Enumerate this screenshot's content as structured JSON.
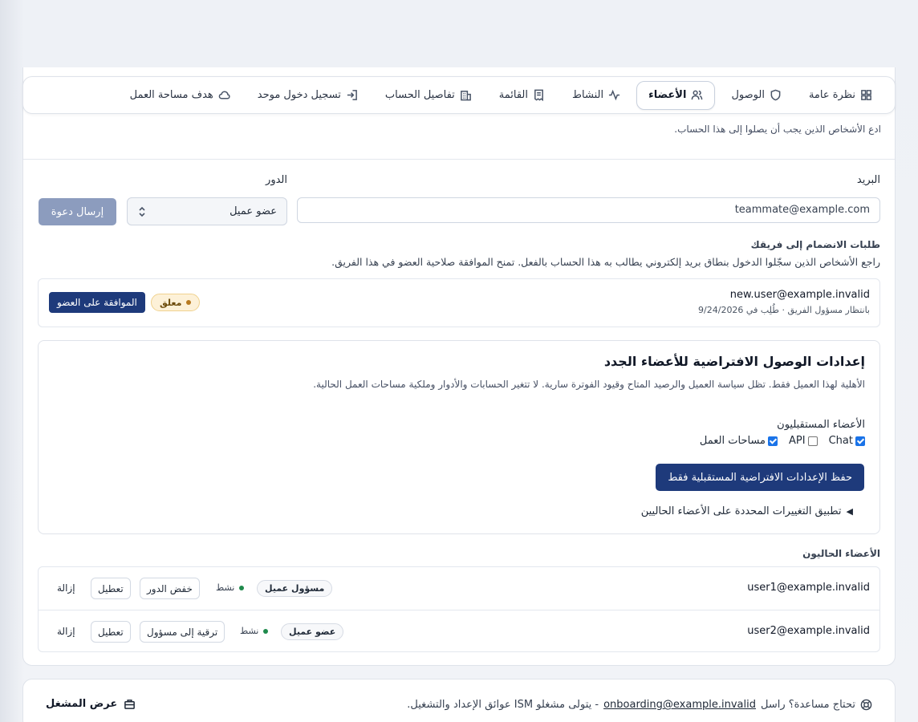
{
  "tabs": [
    {
      "label": "نظرة عامة",
      "icon": "grid-icon"
    },
    {
      "label": "الوصول",
      "icon": "shield-icon"
    },
    {
      "label": "الأعضاء",
      "icon": "users-icon",
      "active": true
    },
    {
      "label": "النشاط",
      "icon": "activity-icon"
    },
    {
      "label": "القائمة",
      "icon": "receipt-icon"
    },
    {
      "label": "تفاصيل الحساب",
      "icon": "building-icon"
    },
    {
      "label": "تسجيل دخول موحد",
      "icon": "sign-in-icon"
    },
    {
      "label": "هدف مساحة العمل",
      "icon": "cloud-icon"
    }
  ],
  "invite": {
    "description": "ادع الأشخاص الذين يجب أن يصلوا إلى هذا الحساب.",
    "email_label": "البريد",
    "email_value": "teammate@example.com",
    "role_label": "الدور",
    "role_value": "عضو عميل",
    "send_button": "إرسال دعوة"
  },
  "join_requests": {
    "title": "طلبات الانضمام إلى فريقك",
    "description": "راجع الأشخاص الذين سجّلوا الدخول بنطاق بريد إلكتروني يطالب به هذا الحساب بالفعل. تمنح الموافقة صلاحية العضو في هذا الفريق.",
    "items": [
      {
        "email": "new.user@example.invalid",
        "subtitle": "بانتظار مسؤول الفريق · طُلِب في 9/24/2026",
        "status": "معلق",
        "approve_button": "الموافقة على العضو"
      }
    ]
  },
  "defaults": {
    "title": "إعدادات الوصول الافتراضية للأعضاء الجدد",
    "description": "الأهلية لهذا العميل فقط. تظل سياسة العميل والرصيد المتاح وقيود الفوترة سارية. لا تتغير الحسابات والأدوار وملكية مساحات العمل الحالية.",
    "future_members_label": "الأعضاء المستقبليون",
    "options": [
      {
        "label": "Chat",
        "checked": true
      },
      {
        "label": "API",
        "checked": false
      },
      {
        "label": "مساحات العمل",
        "checked": true
      }
    ],
    "save_button": "حفظ الإعدادات الافتراضية المستقبلية فقط",
    "apply_existing": "تطبيق التغييرات المحددة على الأعضاء الحاليين"
  },
  "members": {
    "title": "الأعضاء الحاليون",
    "rows": [
      {
        "email": "user1@example.invalid",
        "role": "مسؤول عميل",
        "status": "نشط",
        "change_role": "خفض الدور",
        "disable": "تعطيل",
        "remove": "إزالة"
      },
      {
        "email": "user2@example.invalid",
        "role": "عضو عميل",
        "status": "نشط",
        "change_role": "ترقية إلى مسؤول",
        "disable": "تعطيل",
        "remove": "إزالة"
      }
    ]
  },
  "help": {
    "prefix": "تحتاج مساعدة؟ راسل",
    "email": "onboarding@example.invalid",
    "suffix": "- يتولى مشغلو ISM عوائق الإعداد والتشغيل.",
    "operator_button": "عرض المشغل"
  },
  "colors": {
    "primary": "#1e3a7b",
    "disabled_button": "#8c9cbe",
    "pending_badge_bg": "#fdf1d8",
    "active_dot": "#1f8a4c"
  }
}
